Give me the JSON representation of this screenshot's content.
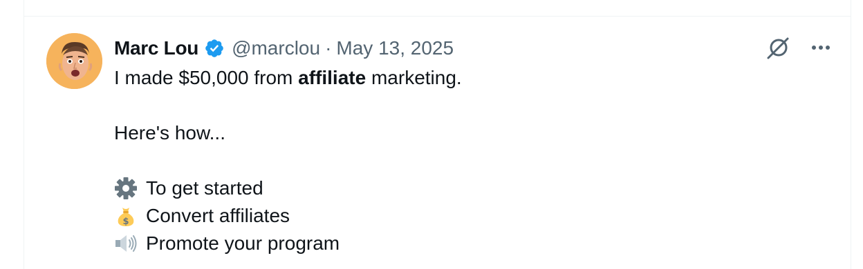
{
  "post": {
    "author_name": "Marc Lou",
    "handle": "@marclou",
    "separator": "·",
    "date": "May 13, 2025",
    "text": {
      "line1_prefix": "I made $50,000 from ",
      "line1_bold": "affiliate",
      "line1_suffix": " marketing.",
      "line2": "Here's how...",
      "bullets": [
        {
          "icon": "gear-icon",
          "label": "To get started"
        },
        {
          "icon": "money-bag-icon",
          "label": "Convert affiliates"
        },
        {
          "icon": "speaker-icon",
          "label": "Promote your program"
        }
      ]
    }
  },
  "colors": {
    "verified": "#1d9bf0",
    "muted_text": "#536471",
    "avatar_bg": "#f6b35c"
  }
}
